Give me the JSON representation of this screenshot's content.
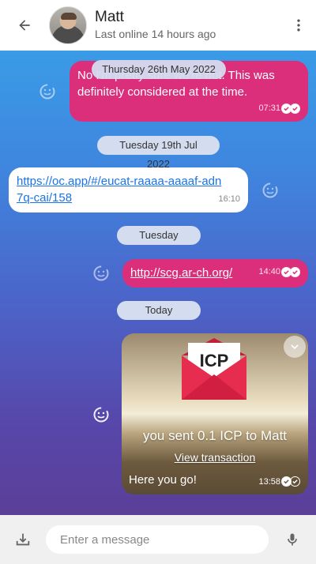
{
  "header": {
    "contact_name": "Matt",
    "last_online": "Last online 14 hours ago"
  },
  "messages": {
    "m1": {
      "text": "No I'm pretty sure we're not. This was definitely considered at the time.",
      "time": "07:31"
    },
    "pill_thursday": "Thursday 26th May 2022",
    "pill_jul": "Tuesday 19th Jul 2022",
    "m2": {
      "text": "https://oc.app/#/eucat-raaaa-aaaaf-adn7q-cai/158",
      "time": "16:10"
    },
    "pill_tuesday": "Tuesday",
    "m3": {
      "text": "http://scg.ar-ch.org/",
      "time": "14:40"
    },
    "pill_today": "Today",
    "m4": {
      "envelope_label": "ICP",
      "sent_text": "you sent 0.1 ICP to Matt",
      "view_link": "View transaction",
      "caption": "Here you go!",
      "time": "13:58"
    }
  },
  "composer": {
    "placeholder": "Enter a message"
  },
  "colors": {
    "outgoing_bubble": "#db2f7c",
    "incoming_bubble": "#ffffff",
    "date_pill": "#d4dcef",
    "chat_bg_top": "#3a9be6",
    "chat_bg_bottom": "#5b3f98"
  },
  "icons": {
    "back": "arrow-left-icon",
    "menu": "kebab-menu-icon",
    "react": "add-reaction-icon",
    "attach": "upload-icon",
    "mic": "microphone-icon",
    "expand": "chevron-down-icon",
    "read": "double-check-icon"
  }
}
